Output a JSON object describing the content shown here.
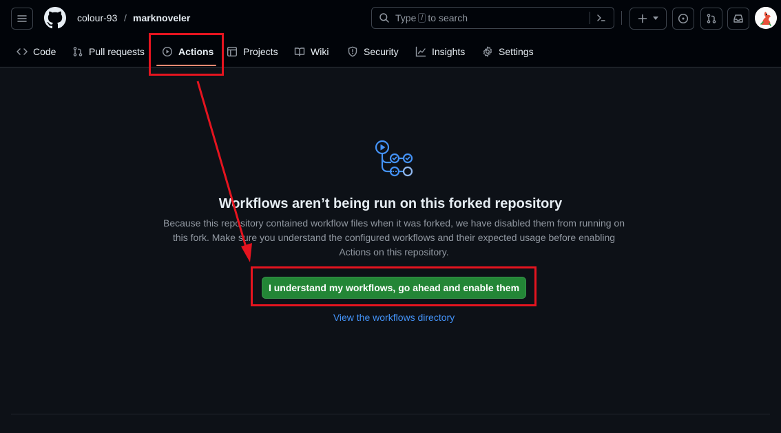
{
  "header": {
    "owner": "colour-93",
    "separator": "/",
    "repo": "marknoveler",
    "search": {
      "prefix": "Type",
      "key": "/",
      "suffix": "to search"
    },
    "icons": [
      "menu-icon",
      "github-logo-icon",
      "command-palette-icon",
      "plus-icon",
      "triangle-down-icon",
      "issues-icon",
      "pull-requests-icon",
      "inbox-icon",
      "avatar"
    ]
  },
  "nav": {
    "tabs": [
      {
        "label": "Code",
        "icon": "code-icon"
      },
      {
        "label": "Pull requests",
        "icon": "git-pull-request-icon"
      },
      {
        "label": "Actions",
        "icon": "play-icon",
        "selected": true
      },
      {
        "label": "Projects",
        "icon": "table-icon"
      },
      {
        "label": "Wiki",
        "icon": "book-icon"
      },
      {
        "label": "Security",
        "icon": "shield-icon"
      },
      {
        "label": "Insights",
        "icon": "graph-icon"
      },
      {
        "label": "Settings",
        "icon": "gear-icon"
      }
    ]
  },
  "main": {
    "icon": "workflow-icon",
    "title": "Workflows aren’t being run on this forked repository",
    "description": "Because this repository contained workflow files when it was forked, we have disabled them from running on this fork. Make sure you understand the configured workflows and their expected usage before enabling Actions on this repository.",
    "enable_button": "I understand my workflows, go ahead and enable them",
    "directory_link": "View the workflows directory"
  },
  "colors": {
    "background": "#0d1117",
    "header_bg": "#010409",
    "accent_green": "#238636",
    "link_blue": "#4493f8",
    "active_tab_underline": "#fd8c73",
    "annotation_red": "#e5141f"
  }
}
